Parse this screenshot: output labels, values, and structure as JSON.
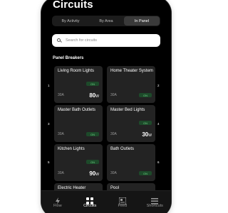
{
  "page": {
    "title": "Circuits"
  },
  "tabs": [
    {
      "label": "By Activity",
      "active": false
    },
    {
      "label": "By Area",
      "active": false
    },
    {
      "label": "In Panel",
      "active": true
    }
  ],
  "search": {
    "placeholder": "Search for circuits"
  },
  "section": {
    "label": "Panel Breakers"
  },
  "breakers": [
    {
      "slot": "1",
      "name": "Living Room Lights",
      "amps": "30A",
      "status": "ON",
      "power": "80",
      "unit": "W"
    },
    {
      "slot": "2",
      "name": "Home Theater System",
      "amps": "30A",
      "status": "ON",
      "power": "",
      "unit": ""
    },
    {
      "slot": "3",
      "name": "Master Bath Outlets",
      "amps": "30A",
      "status": "ON",
      "power": "",
      "unit": ""
    },
    {
      "slot": "4",
      "name": "Master Bed Lights",
      "amps": "30A",
      "status": "ON",
      "power": "30",
      "unit": "W"
    },
    {
      "slot": "5",
      "name": "Kitchen Lights",
      "amps": "30A",
      "status": "ON",
      "power": "90",
      "unit": "W"
    },
    {
      "slot": "6",
      "name": "Bath Outlets",
      "amps": "30A",
      "status": "ON",
      "power": "",
      "unit": ""
    },
    {
      "slot": "",
      "name": "Electric Heater",
      "amps": "",
      "status": "",
      "power": "",
      "unit": ""
    },
    {
      "slot": "",
      "name": "Pool",
      "amps": "",
      "status": "",
      "power": "",
      "unit": ""
    }
  ],
  "nav": [
    {
      "label": "Flow",
      "icon": "flow-icon",
      "active": false
    },
    {
      "label": "Circuits",
      "icon": "circuits-icon",
      "active": true
    },
    {
      "label": "Feed",
      "icon": "feed-icon",
      "active": false
    },
    {
      "label": "Shortcuts",
      "icon": "shortcuts-icon",
      "active": false
    }
  ],
  "colors": {
    "background": "#000000",
    "card": "#232323",
    "accent_green": "#6fcf86",
    "pill_bg": "#1d4a2a"
  }
}
